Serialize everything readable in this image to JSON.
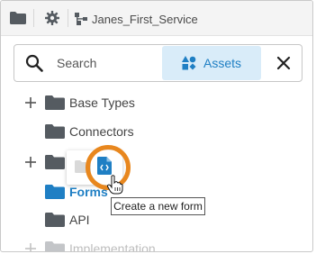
{
  "toolbar": {
    "service_name": "Janes_First_Service"
  },
  "search": {
    "placeholder": "Search",
    "assets_label": "Assets"
  },
  "tree": {
    "items": [
      {
        "label": "Base Types",
        "expandable": true
      },
      {
        "label": "Connectors",
        "expandable": false
      },
      {
        "label": "",
        "expandable": true
      },
      {
        "label": "Forms",
        "expandable": false,
        "highlighted": true
      },
      {
        "label": "API",
        "expandable": false
      },
      {
        "label": "Implementation",
        "expandable": true
      }
    ]
  },
  "tooltip": {
    "text": "Create a new form"
  },
  "colors": {
    "accent": "#1f7fc4",
    "assets_bg": "#d9ecf9",
    "highlight_ring": "#e8871e",
    "folder": "#555b61"
  },
  "icons": {
    "folder": "folder-icon",
    "gear": "gear-icon",
    "service": "service-icon",
    "search": "search-icon",
    "assets": "assets-icon",
    "close": "close-icon",
    "expand": "plus-icon",
    "new_form": "new-form-icon",
    "cursor": "hand-cursor-icon"
  }
}
